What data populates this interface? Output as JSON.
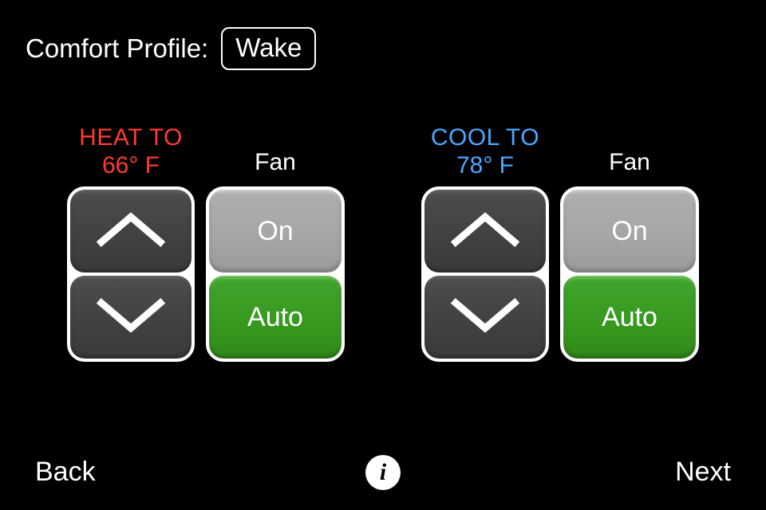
{
  "header": {
    "profile_label": "Comfort Profile:",
    "profile_value": "Wake"
  },
  "heat": {
    "mode_label": "HEAT TO",
    "temp_display": "66° F",
    "fan_title": "Fan",
    "fan_on_label": "On",
    "fan_auto_label": "Auto"
  },
  "cool": {
    "mode_label": "COOL TO",
    "temp_display": "78° F",
    "fan_title": "Fan",
    "fan_on_label": "On",
    "fan_auto_label": "Auto"
  },
  "footer": {
    "back_label": "Back",
    "info_label": "i",
    "next_label": "Next"
  },
  "colors": {
    "heat": "#ff3b30",
    "cool": "#4aa8ff",
    "active_green": "#3fa328",
    "inactive_gray": "#a8a8a8"
  }
}
